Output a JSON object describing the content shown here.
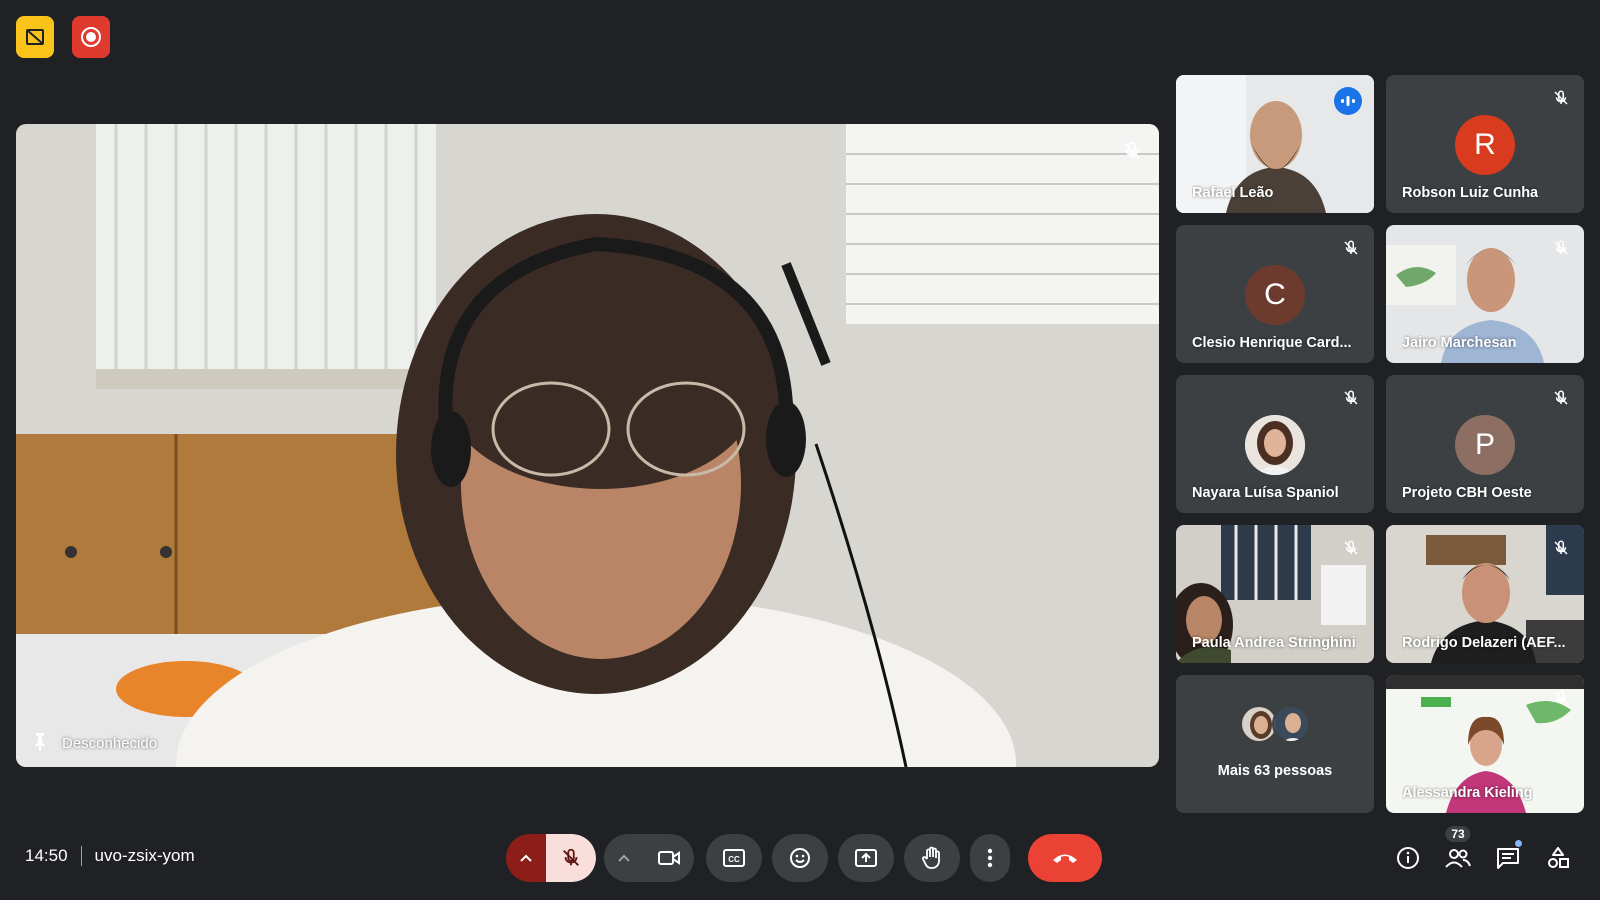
{
  "meeting": {
    "time": "14:50",
    "code": "uvo-zsix-yom"
  },
  "main_tile": {
    "name": "Desconhecido"
  },
  "participants": [
    {
      "name": "Rafael Leão",
      "type": "video",
      "active": true,
      "speaking": true
    },
    {
      "name": "Robson Luiz Cunha",
      "type": "avatar",
      "initial": "R",
      "color": "#d93b1f"
    },
    {
      "name": "Clesio Henrique Card...",
      "type": "avatar",
      "initial": "C",
      "color": "#6d3b2e"
    },
    {
      "name": "Jairo Marchesan",
      "type": "video"
    },
    {
      "name": "Nayara Luísa Spaniol",
      "type": "photo"
    },
    {
      "name": "Projeto CBH Oeste",
      "type": "avatar",
      "initial": "P",
      "color": "#8d6e63"
    },
    {
      "name": "Paula Andrea Stringhini",
      "type": "video"
    },
    {
      "name": "Rodrigo Delazeri (AEF...",
      "type": "video"
    },
    {
      "name": "Mais 63 pessoas",
      "type": "more"
    },
    {
      "name": "Alessandra Kieling",
      "type": "video"
    }
  ],
  "people_count": "73",
  "colors": {
    "background": "#202124",
    "tile": "#3c4043",
    "end_call": "#ea4335",
    "accent": "#8ab4f8"
  }
}
